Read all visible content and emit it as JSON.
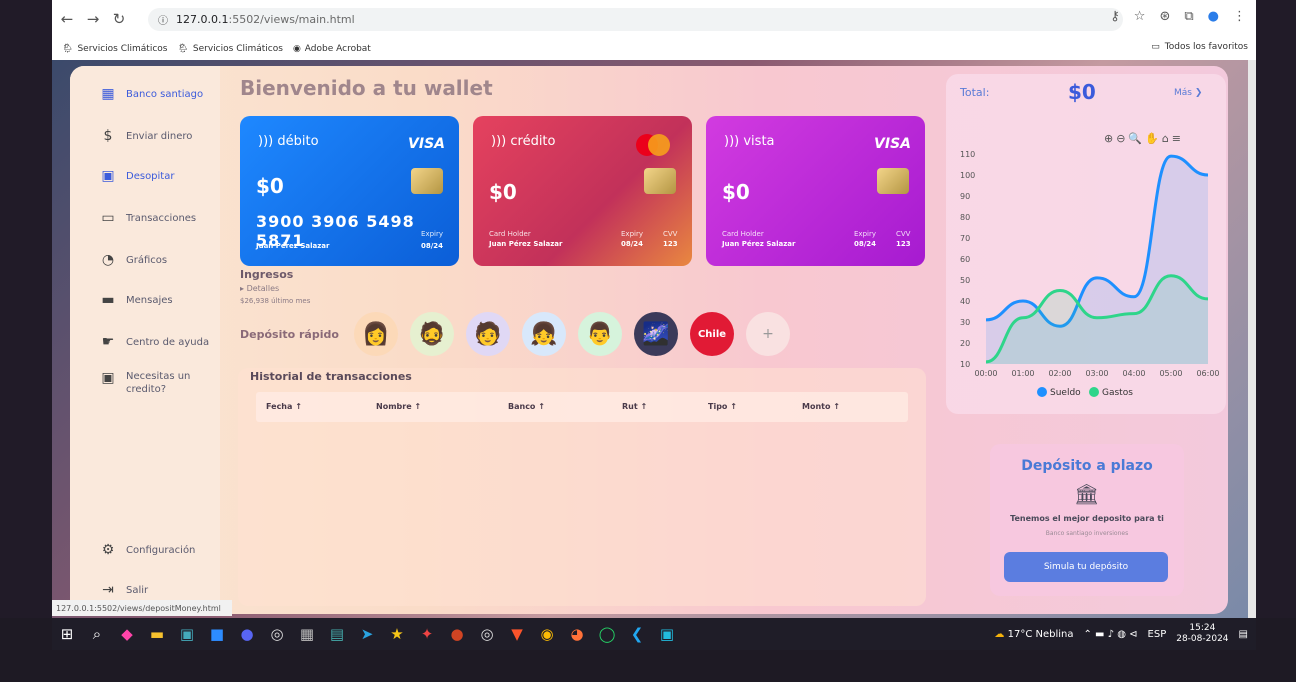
{
  "browser": {
    "url_host": "127.0.0.1",
    "url_path": ":5502/views/main.html",
    "bookmarks": [
      "Servicios Climáticos",
      "Servicios Climáticos",
      "Adobe Acrobat"
    ],
    "all_bookmarks": "Todos los favoritos",
    "status_url": "127.0.0.1:5502/views/depositMoney.html"
  },
  "sidebar": {
    "items": [
      {
        "label": "Banco santiago",
        "icon": "dashboard-icon"
      },
      {
        "label": "Enviar dinero",
        "icon": "send-money-icon"
      },
      {
        "label": "Desopitar",
        "icon": "deposit-icon"
      },
      {
        "label": "Transacciones",
        "icon": "transactions-icon"
      },
      {
        "label": "Gráficos",
        "icon": "chart-icon"
      },
      {
        "label": "Mensajes",
        "icon": "message-icon"
      },
      {
        "label": "Centro de ayuda",
        "icon": "help-icon"
      },
      {
        "label": "Necesitas un credito?",
        "icon": "money-icon"
      }
    ],
    "config": "Configuración",
    "logout": "Salir"
  },
  "main": {
    "title": "Bienvenido a tu wallet",
    "cards": [
      {
        "type": "débito",
        "brand": "VISA",
        "balance": "$0",
        "number": "3900 3906 5498 5871",
        "holder": "Juan Pérez Salazar",
        "expiry_label": "Expiry",
        "expiry": "08/24"
      },
      {
        "type": "crédito",
        "balance": "$0",
        "holder_label": "Card Holder",
        "holder": "Juan Pérez Salazar",
        "expiry_label": "Expiry",
        "expiry": "08/24",
        "cvv_label": "CVV",
        "cvv": "123"
      },
      {
        "type": "vista",
        "brand": "VISA",
        "balance": "$0",
        "holder_label": "Card Holder",
        "holder": "Juan Pérez Salazar",
        "expiry_label": "Expiry",
        "expiry": "08/24",
        "cvv_label": "CVV",
        "cvv": "123"
      }
    ],
    "ingresos": "Ingresos",
    "detalles": "Detalles",
    "ultimo_mes": "$26,938 último mes",
    "deposito_rapido": "Depósito rápido",
    "chile_label": "Chile",
    "add": "+",
    "history": {
      "title": "Historial de transacciones",
      "columns": [
        "Fecha ↑",
        "Nombre ↑",
        "Banco ↑",
        "Rut ↑",
        "Tipo ↑",
        "Monto ↑"
      ]
    }
  },
  "right": {
    "total_label": "Total:",
    "total_value": "$0",
    "more": "Más",
    "deposit": {
      "title": "Depósito a plazo",
      "subtitle": "Tenemos el mejor deposito para ti",
      "small": "Banco santiago inversiones",
      "button": "Simula tu depósito"
    }
  },
  "chart_data": {
    "type": "area",
    "x": [
      "00:00",
      "01:00",
      "02:00",
      "03:00",
      "04:00",
      "05:00",
      "06:00"
    ],
    "series": [
      {
        "name": "Sueldo",
        "color": "#1e90ff",
        "values": [
          31,
          40,
          28,
          51,
          42,
          109,
          100
        ]
      },
      {
        "name": "Gastos",
        "color": "#2ed58a",
        "values": [
          11,
          32,
          45,
          32,
          34,
          52,
          41
        ]
      }
    ],
    "ylim": [
      10,
      110
    ],
    "yticks": [
      10,
      20,
      30,
      40,
      50,
      60,
      70,
      80,
      90,
      100,
      110
    ],
    "legend": "bottom"
  },
  "taskbar": {
    "weather": "17°C  Neblina",
    "lang": "ESP",
    "time": "15:24",
    "date": "28-08-2024"
  }
}
